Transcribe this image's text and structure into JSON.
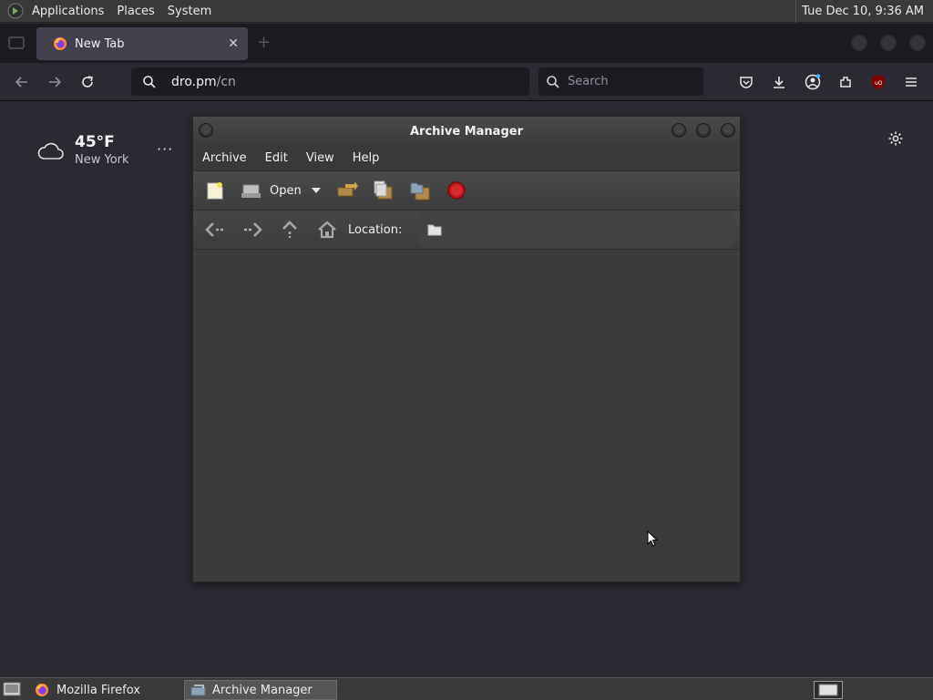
{
  "top_panel": {
    "menus": [
      "Applications",
      "Places",
      "System"
    ],
    "clock": "Tue Dec 10,  9:36 AM"
  },
  "firefox": {
    "tab_title": "New Tab",
    "url_host": "dro.pm",
    "url_path": "/cn",
    "search_placeholder": "Search",
    "weather": {
      "temp": "45°F",
      "city": "New York",
      "more": "···"
    }
  },
  "archive_manager": {
    "title": "Archive Manager",
    "menus": [
      "Archive",
      "Edit",
      "View",
      "Help"
    ],
    "open_label": "Open",
    "location_label": "Location:"
  },
  "taskbar": {
    "firefox": "Mozilla Firefox",
    "archive": "Archive Manager"
  },
  "colors": {
    "panel": "#3a3a3a",
    "firefox_bg": "#2b2a33",
    "window_bg": "#3b3b3b"
  }
}
